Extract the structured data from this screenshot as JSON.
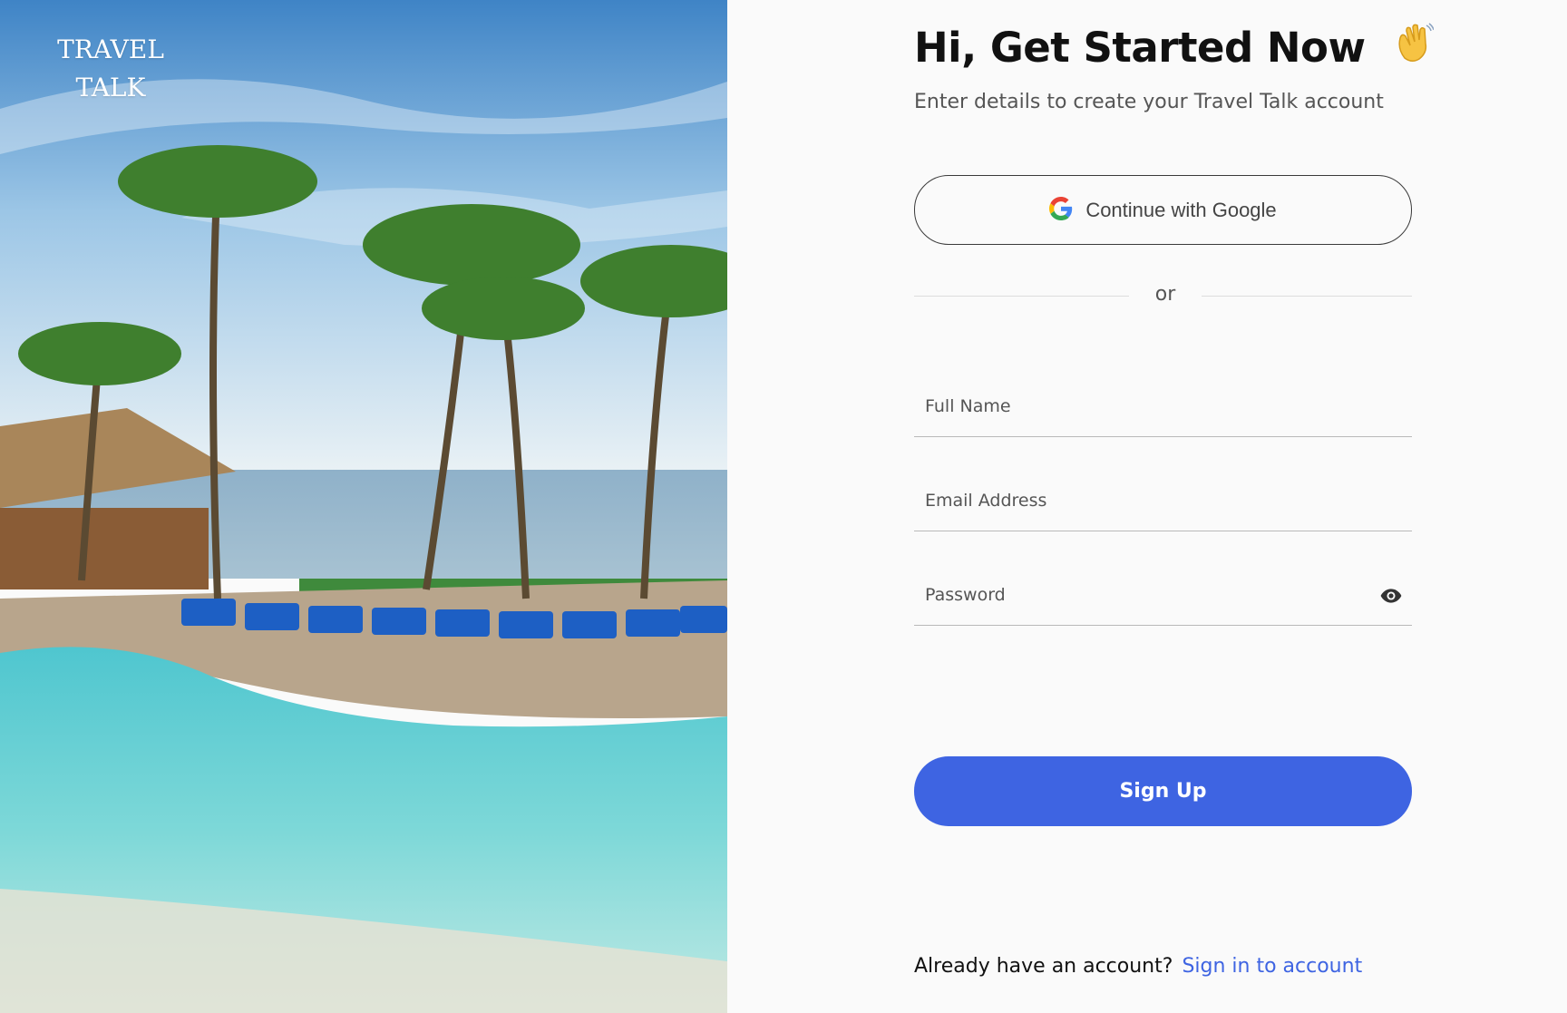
{
  "brand": {
    "line1": "TRAVEL",
    "line2": "TALK"
  },
  "hero": {
    "image": "tropical-resort-pool-beach-palms"
  },
  "header": {
    "title": "Hi, Get Started Now",
    "title_emoji_icon": "waving-hand-icon",
    "subtitle": "Enter details to create your Travel Talk account"
  },
  "google": {
    "label": "Continue with Google",
    "icon": "google-icon"
  },
  "divider": {
    "text": "or"
  },
  "form": {
    "full_name": {
      "placeholder": "Full Name",
      "value": ""
    },
    "email": {
      "placeholder": "Email Address",
      "value": ""
    },
    "password": {
      "placeholder": "Password",
      "value": "",
      "toggle_icon": "eye-icon"
    }
  },
  "signup": {
    "label": "Sign Up"
  },
  "footer": {
    "prompt": "Already have an account?",
    "link": "Sign in to account"
  },
  "colors": {
    "accent": "#3e64e2",
    "background": "#fafafa",
    "text": "#111111"
  }
}
